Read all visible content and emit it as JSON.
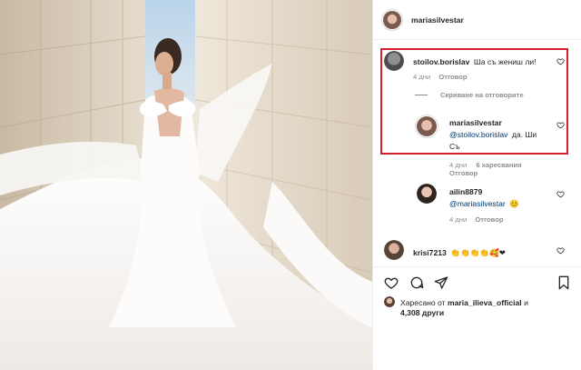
{
  "post": {
    "author": "mariasilvestar"
  },
  "comments": {
    "c1": {
      "user": "stoilov.borislav",
      "text": "Ша съ жениш ли!",
      "time": "4 дни",
      "reply": "Отговор"
    },
    "hide_replies": "Скриване на отговорите",
    "r1": {
      "user": "mariasilvestar",
      "mention": "@stoilov.borislav",
      "text_line1": "да. Ши",
      "text_line2": "Съ",
      "time": "4 дни",
      "likes": "6 харесвания",
      "reply": "Отговор"
    },
    "r2": {
      "user": "ailin8879",
      "mention": "@mariasilvestar",
      "emoji": "😊",
      "time": "4 дни",
      "reply": "Отговор"
    },
    "c2": {
      "user": "krisi7213",
      "text": "👏👏👏👏🥰❤"
    }
  },
  "likes_summary": {
    "prefix": "Харесано от",
    "user": "maria_ilieva_official",
    "suffix": "и",
    "count": "4,308 други"
  },
  "icons": {
    "like": "heart-icon",
    "comment": "comment-icon",
    "share": "share-icon",
    "save": "bookmark-icon"
  },
  "colors": {
    "highlight": "#d4202c",
    "link": "#00376b",
    "muted": "#8e8e8e"
  }
}
